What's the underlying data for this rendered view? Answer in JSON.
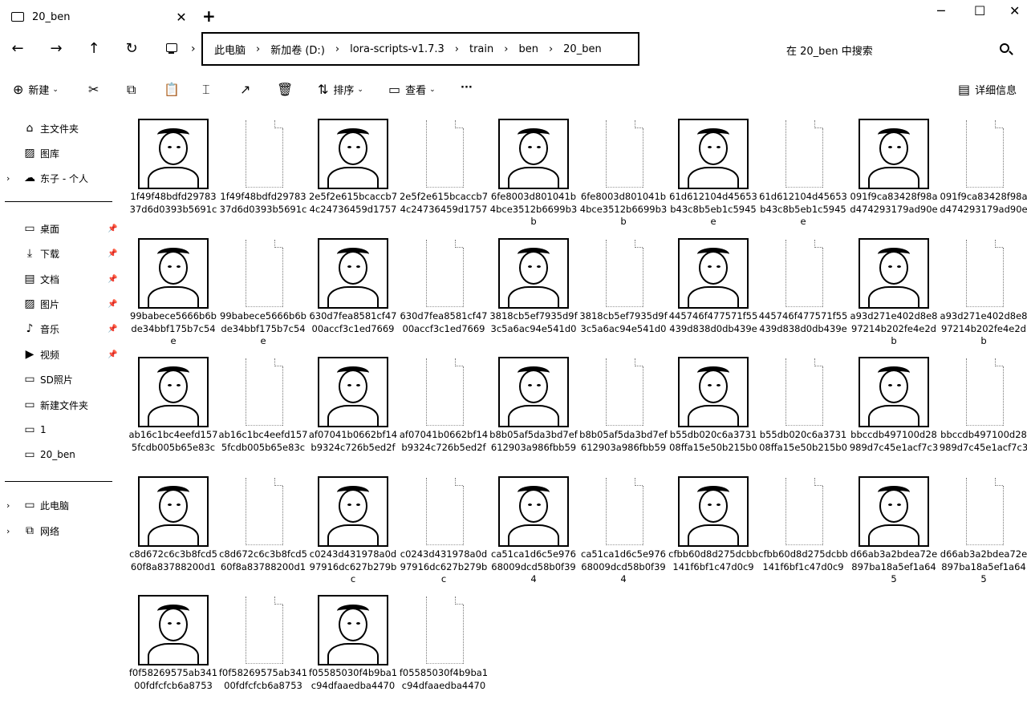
{
  "window": {
    "tab_title": "20_ben",
    "tab_close": "✕",
    "new_tab": "+",
    "minimize": "─",
    "maximize": "☐",
    "close": "✕"
  },
  "nav": {
    "back": "←",
    "forward": "→",
    "up": "↑",
    "refresh": "↻",
    "breadcrumb": [
      "此电脑",
      "新加卷 (D:)",
      "lora-scripts-v1.7.3",
      "train",
      "ben",
      "20_ben"
    ],
    "separator": "›",
    "search_placeholder": "在 20_ben 中搜索"
  },
  "toolbar": {
    "new_label": "新建",
    "new_icon": "⊕",
    "cut_icon": "✂",
    "copy_icon": "⧉",
    "paste_icon": "📋",
    "rename_icon": "⌶",
    "share_icon": "↗",
    "delete_icon": "🗑",
    "sort_label": "排序",
    "sort_icon": "⇅",
    "view_label": "查看",
    "view_icon": "▭",
    "more_label": "···",
    "details_label": "详细信息",
    "details_icon": "▤",
    "caret": "⌄"
  },
  "sidebar": {
    "items": [
      {
        "label": "主文件夹",
        "icon": "⌂",
        "expand": "",
        "pin": ""
      },
      {
        "label": "图库",
        "icon": "▨",
        "expand": "",
        "pin": ""
      },
      {
        "label": "东子 - 个人",
        "icon": "☁",
        "expand": "›",
        "pin": ""
      },
      {
        "label": "桌面",
        "icon": "▭",
        "expand": "",
        "pin": "📌"
      },
      {
        "label": "下载",
        "icon": "⤓",
        "expand": "",
        "pin": "📌"
      },
      {
        "label": "文档",
        "icon": "▤",
        "expand": "",
        "pin": "📌"
      },
      {
        "label": "图片",
        "icon": "▨",
        "expand": "",
        "pin": "📌"
      },
      {
        "label": "音乐",
        "icon": "♪",
        "expand": "",
        "pin": "📌"
      },
      {
        "label": "视频",
        "icon": "▶",
        "expand": "",
        "pin": "📌"
      },
      {
        "label": "SD照片",
        "icon": "▭",
        "expand": "",
        "pin": ""
      },
      {
        "label": "新建文件夹",
        "icon": "▭",
        "expand": "",
        "pin": ""
      },
      {
        "label": "1",
        "icon": "▭",
        "expand": "",
        "pin": ""
      },
      {
        "label": "20_ben",
        "icon": "▭",
        "expand": "",
        "pin": ""
      },
      {
        "label": "此电脑",
        "icon": "▭",
        "expand": "›",
        "pin": ""
      },
      {
        "label": "网络",
        "icon": "⧉",
        "expand": "›",
        "pin": ""
      }
    ]
  },
  "files": [
    {
      "name": "1f49f48bdfd2978337d6d0393b5691c",
      "kind": "image"
    },
    {
      "name": "1f49f48bdfd2978337d6d0393b5691c",
      "kind": "txt"
    },
    {
      "name": "2e5f2e615bcaccb74c24736459d1757",
      "kind": "image"
    },
    {
      "name": "2e5f2e615bcaccb74c24736459d1757",
      "kind": "txt"
    },
    {
      "name": "6fe8003d801041b4bce3512b6699b3b",
      "kind": "image"
    },
    {
      "name": "6fe8003d801041b4bce3512b6699b3b",
      "kind": "txt"
    },
    {
      "name": "61d612104d45653b43c8b5eb1c5945e",
      "kind": "image"
    },
    {
      "name": "61d612104d45653b43c8b5eb1c5945e",
      "kind": "txt"
    },
    {
      "name": "091f9ca83428f98ad474293179ad90e",
      "kind": "image"
    },
    {
      "name": "091f9ca83428f98ad474293179ad90e",
      "kind": "txt"
    },
    {
      "name": "99babece5666b6bde34bbf175b7c54e",
      "kind": "image"
    },
    {
      "name": "99babece5666b6bde34bbf175b7c54e",
      "kind": "txt"
    },
    {
      "name": "630d7fea8581cf4700accf3c1ed7669",
      "kind": "image"
    },
    {
      "name": "630d7fea8581cf4700accf3c1ed7669",
      "kind": "txt"
    },
    {
      "name": "3818cb5ef7935d9f3c5a6ac94e541d0",
      "kind": "image"
    },
    {
      "name": "3818cb5ef7935d9f3c5a6ac94e541d0",
      "kind": "txt"
    },
    {
      "name": "445746f477571f55439d838d0db439e",
      "kind": "image"
    },
    {
      "name": "445746f477571f55439d838d0db439e",
      "kind": "txt"
    },
    {
      "name": "a93d271e402d8e897214b202fe4e2db",
      "kind": "image"
    },
    {
      "name": "a93d271e402d8e897214b202fe4e2db",
      "kind": "txt"
    },
    {
      "name": "ab16c1bc4eefd1575fcdb005b65e83c",
      "kind": "image"
    },
    {
      "name": "ab16c1bc4eefd1575fcdb005b65e83c",
      "kind": "txt"
    },
    {
      "name": "af07041b0662bf14b9324c726b5ed2f",
      "kind": "image"
    },
    {
      "name": "af07041b0662bf14b9324c726b5ed2f",
      "kind": "txt"
    },
    {
      "name": "b8b05af5da3bd7ef612903a986fbb59",
      "kind": "image"
    },
    {
      "name": "b8b05af5da3bd7ef612903a986fbb59",
      "kind": "txt"
    },
    {
      "name": "b55db020c6a373108ffa15e50b215b0",
      "kind": "image"
    },
    {
      "name": "b55db020c6a373108ffa15e50b215b0",
      "kind": "txt"
    },
    {
      "name": "bbccdb497100d28989d7c45e1acf7c3",
      "kind": "image"
    },
    {
      "name": "bbccdb497100d28989d7c45e1acf7c3",
      "kind": "txt"
    },
    {
      "name": "c8d672c6c3b8fcd560f8a83788200d1",
      "kind": "image"
    },
    {
      "name": "c8d672c6c3b8fcd560f8a83788200d1",
      "kind": "txt"
    },
    {
      "name": "c0243d431978a0d97916dc627b279bc",
      "kind": "image"
    },
    {
      "name": "c0243d431978a0d97916dc627b279bc",
      "kind": "txt"
    },
    {
      "name": "ca51ca1d6c5e97668009dcd58b0f394",
      "kind": "image"
    },
    {
      "name": "ca51ca1d6c5e97668009dcd58b0f394",
      "kind": "txt"
    },
    {
      "name": "cfbb60d8d275dcbb141f6bf1c47d0c9",
      "kind": "image"
    },
    {
      "name": "cfbb60d8d275dcbb141f6bf1c47d0c9",
      "kind": "txt"
    },
    {
      "name": "d66ab3a2bdea72e897ba18a5ef1a645",
      "kind": "image"
    },
    {
      "name": "d66ab3a2bdea72e897ba18a5ef1a645",
      "kind": "txt"
    },
    {
      "name": "f0f58269575ab34100fdfcfcb6a8753",
      "kind": "image"
    },
    {
      "name": "f0f58269575ab34100fdfcfcb6a8753",
      "kind": "txt"
    },
    {
      "name": "f05585030f4b9ba1c94dfaaedba4470",
      "kind": "image"
    },
    {
      "name": "f05585030f4b9ba1c94dfaaedba4470",
      "kind": "txt"
    }
  ]
}
